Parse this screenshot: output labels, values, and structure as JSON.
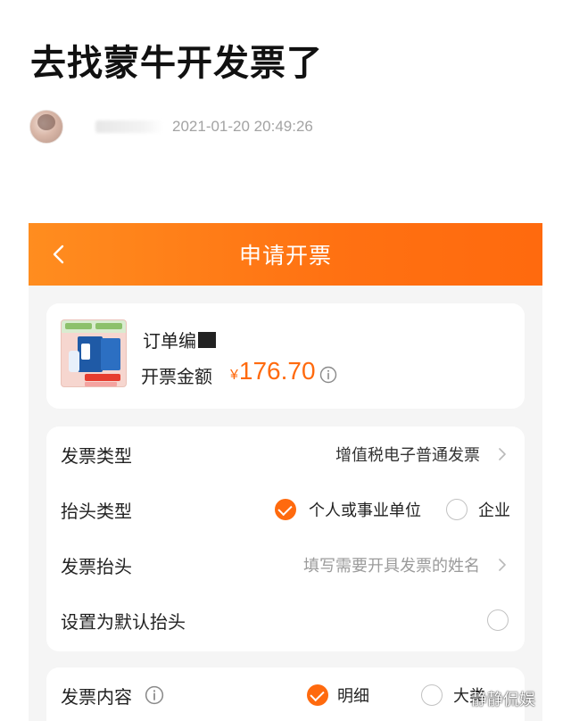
{
  "article": {
    "title": "去找蒙牛开发票了",
    "publish_time": "2021-01-20 20:49:26"
  },
  "screen": {
    "nav_title": "申请开票",
    "order": {
      "number_label": "订单编",
      "amount_label": "开票金额",
      "currency": "¥",
      "amount": "176.70"
    },
    "form": {
      "invoice_type_label": "发票类型",
      "invoice_type_value": "增值税电子普通发票",
      "title_type_label": "抬头类型",
      "title_type_options": [
        "个人或事业单位",
        "企业"
      ],
      "title_type_selected": "个人或事业单位",
      "invoice_title_label": "发票抬头",
      "invoice_title_placeholder": "填写需要开具发票的姓名",
      "default_title_label": "设置为默认抬头",
      "default_title_checked": false
    },
    "content": {
      "label": "发票内容",
      "options": [
        "明细",
        "大类"
      ],
      "selected": "明细"
    }
  },
  "watermark": "静静侃娱",
  "colors": {
    "accent": "#ff6a0e",
    "nav_gradient_start": "#ff8d1f",
    "nav_gradient_end": "#ff6a0e"
  },
  "icons": {
    "back": "back-arrow-icon",
    "info": "info-icon",
    "chevron": "chevron-right-icon",
    "check": "check-icon"
  }
}
